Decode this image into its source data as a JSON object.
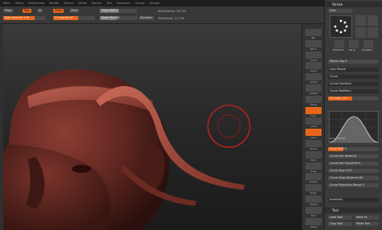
{
  "menu": [
    "Menu",
    "Movie",
    "Preferences",
    "Render",
    "Stencil",
    "Stroke",
    "Texture",
    "Tool",
    "Transform",
    "Zscript",
    "Zplugin"
  ],
  "shelf": {
    "mode_buttons": [
      "Mrgb",
      "Rgb",
      "M"
    ],
    "zadd": "Zadd",
    "zsub": "Zsub",
    "rgb_intensity": {
      "label": "Rgb Intensity",
      "value": "100",
      "fraction": 0.75
    },
    "z_intensity": {
      "label": "Z Intensity",
      "value": "61",
      "fraction": 0.6
    },
    "focal_shift": {
      "label": "Focal Shift",
      "value": "0",
      "fraction": 0.5
    },
    "draw_size": {
      "label": "Draw Size",
      "value": "64",
      "fraction": 0.45
    },
    "dynamic_label": "Dynamic",
    "active_points": "ActivePoints: 15,716",
    "total_points": "TotalPoints: 15,716"
  },
  "right_shelf": [
    {
      "label": "Bpr",
      "orange": false
    },
    {
      "label": "SPix 3",
      "orange": false
    },
    {
      "label": "Scroll",
      "orange": false
    },
    {
      "label": "Zoom",
      "orange": false
    },
    {
      "label": "Actual",
      "orange": false
    },
    {
      "label": "AAHalf",
      "orange": false
    },
    {
      "label": "Persp",
      "orange": false
    },
    {
      "label": "Floor",
      "orange": true
    },
    {
      "label": "L.Sym",
      "orange": false
    },
    {
      "label": "Gxyz",
      "orange": true
    },
    {
      "label": "Frame",
      "orange": false
    },
    {
      "label": "Move",
      "orange": false
    },
    {
      "label": "Scale",
      "orange": false
    },
    {
      "label": "Rotate",
      "orange": false
    },
    {
      "label": "PolyF",
      "orange": false
    },
    {
      "label": "Transp",
      "orange": false
    },
    {
      "label": "Solo",
      "orange": false
    },
    {
      "label": "Xpose",
      "orange": false
    }
  ],
  "panel": {
    "stroke_title": "Stroke",
    "stroke_type": "Dots",
    "thumb_labels": [
      "FreeHand",
      "Spray",
      "DragRect"
    ],
    "mouse_avg": "Mouse Avg 4",
    "sections": [
      "Lazy Mouse",
      "Curve",
      "Curve Functions",
      "Curve Modifiers"
    ],
    "intensity": {
      "label": "Intensity",
      "value": "100"
    },
    "focal_shift": "Focal Shift 0",
    "falloff_labels": [
      "Curve Falloff"
    ],
    "sub_rows": [
      "Curve Edit Radius 8",
      "Curve Edit FocalShift 0",
      "Curve Step 0.05",
      "Curve Snap Distance 60",
      "Curve Projection Range 2"
    ],
    "inventory": "Inventory",
    "tool_title": "Tool",
    "tool_buttons": [
      "Load Tool",
      "Save As",
      "Copy Tool",
      "Paste Tool"
    ]
  }
}
